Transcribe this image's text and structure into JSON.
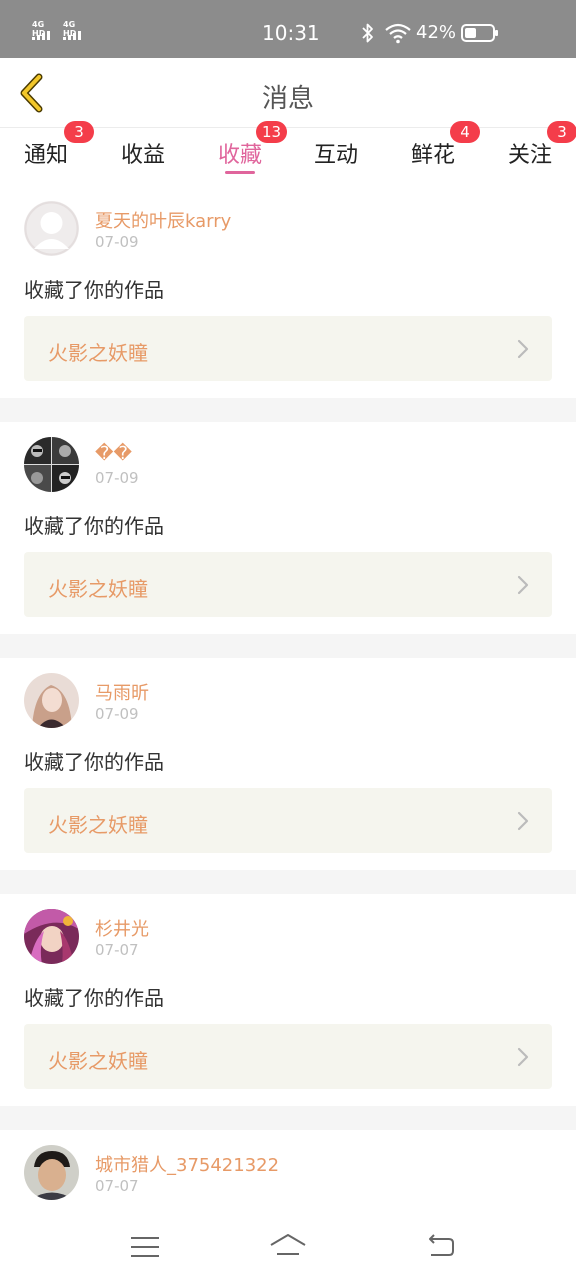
{
  "status_bar": {
    "signal_1": "4G HD",
    "signal_2": "4G HD",
    "time": "10:31",
    "battery_percent": "42%",
    "battery_level": 0.42
  },
  "header": {
    "title": "消息"
  },
  "tabs": [
    {
      "label": "通知",
      "badge": "3",
      "active": false
    },
    {
      "label": "收益",
      "badge": "",
      "active": false
    },
    {
      "label": "收藏",
      "badge": "13",
      "active": true
    },
    {
      "label": "互动",
      "badge": "",
      "active": false
    },
    {
      "label": "鲜花",
      "badge": "4",
      "active": false
    },
    {
      "label": "关注",
      "badge": "3",
      "active": false
    }
  ],
  "items": [
    {
      "username": "夏天的叶辰karry",
      "date": "07-09",
      "action": "收藏了你的作品",
      "work_title": "火影之妖瞳"
    },
    {
      "username": "��",
      "date": "07-09",
      "action": "收藏了你的作品",
      "work_title": "火影之妖瞳"
    },
    {
      "username": "马雨昕",
      "date": "07-09",
      "action": "收藏了你的作品",
      "work_title": "火影之妖瞳"
    },
    {
      "username": "杉井光",
      "date": "07-07",
      "action": "收藏了你的作品",
      "work_title": "火影之妖瞳"
    },
    {
      "username": "城市猎人_375421322",
      "date": "07-07"
    }
  ],
  "colors": {
    "accent_pink": "#e0659c",
    "username_orange": "#e79a67",
    "badge_red": "#f43d4a",
    "card_bg": "#f5f5ee"
  },
  "icons": {
    "back": "chevron-left-icon",
    "arrow": "chevron-right-icon",
    "nav_menu": "menu-icon",
    "nav_home": "home-icon",
    "nav_back": "back-icon"
  }
}
